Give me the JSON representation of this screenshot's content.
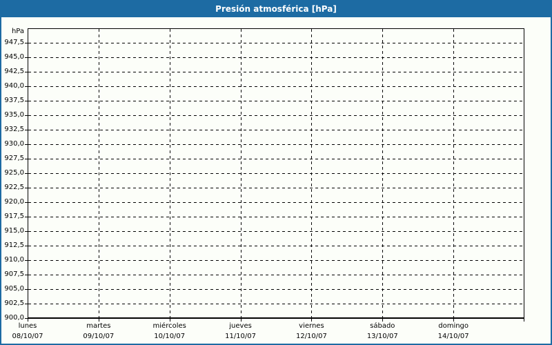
{
  "title_bar": {
    "title": "Presión atmosférica [hPa]"
  },
  "colors": {
    "header": "#1d6ba3",
    "frame": "#1d6ba3",
    "background": "#fcfef9",
    "grid": "#000000",
    "text": "#000000",
    "title_text": "#ffffff"
  },
  "y_axis": {
    "unit_label": "hPa",
    "tick_labels": [
      "947,5",
      "945,0",
      "942,5",
      "940,0",
      "937,5",
      "935,0",
      "932,5",
      "930,0",
      "927,5",
      "925,0",
      "922,5",
      "920,0",
      "917,5",
      "915,0",
      "912,5",
      "910,0",
      "907,5",
      "905,0",
      "902,5",
      "900,0"
    ]
  },
  "x_axis": {
    "days": [
      {
        "name": "lunes",
        "date": "08/10/07"
      },
      {
        "name": "martes",
        "date": "09/10/07"
      },
      {
        "name": "miércoles",
        "date": "10/10/07"
      },
      {
        "name": "jueves",
        "date": "11/10/07"
      },
      {
        "name": "viernes",
        "date": "12/10/07"
      },
      {
        "name": "sábado",
        "date": "13/10/07"
      },
      {
        "name": "domingo",
        "date": "14/10/07"
      }
    ]
  },
  "chart_data": {
    "type": "line",
    "title": "Presión atmosférica [hPa]",
    "xlabel": "",
    "ylabel": "hPa",
    "ylim": [
      900,
      950
    ],
    "ytick_step": 2.5,
    "categories": [
      "lunes 08/10/07",
      "martes 09/10/07",
      "miércoles 10/10/07",
      "jueves 11/10/07",
      "viernes 12/10/07",
      "sábado 13/10/07",
      "domingo 14/10/07"
    ],
    "series": [],
    "grid": "dashed-both-axes",
    "legend": "none",
    "note": "empty chart - no data points plotted"
  }
}
